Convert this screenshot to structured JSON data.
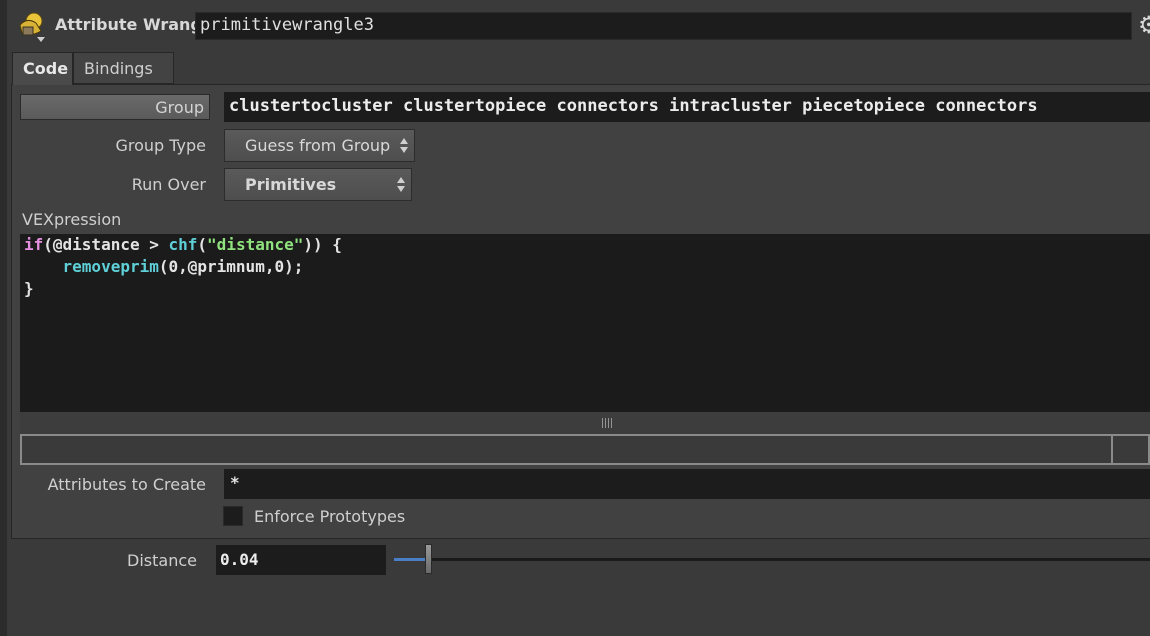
{
  "header": {
    "node_type": "Attribute Wrangle",
    "node_name": "primitivewrangle3",
    "node_icon": "wrangle-node-icon",
    "settings_icon": "gear-icon"
  },
  "tabs": [
    {
      "label": "Code",
      "active": true
    },
    {
      "label": "Bindings",
      "active": false
    }
  ],
  "params": {
    "group": {
      "label": "Group",
      "value": "clustertocluster clustertopiece connectors intracluster piecetopiece connectors"
    },
    "group_type": {
      "label": "Group Type",
      "value": "Guess from Group"
    },
    "run_over": {
      "label": "Run Over",
      "value": "Primitives"
    },
    "vexpression": {
      "label": "VEXpression",
      "code": [
        "if(@distance > chf(\"distance\")) {",
        "    removeprim(0,@primnum,0);",
        "}"
      ]
    },
    "attributes_to_create": {
      "label": "Attributes to Create",
      "value": "*"
    },
    "enforce_prototypes": {
      "label": "Enforce Prototypes",
      "checked": false
    },
    "distance": {
      "label": "Distance",
      "value": "0.04",
      "slider_fraction": 0.045
    }
  },
  "colors": {
    "background": "#3a3a3a",
    "field": "#1c1c1c",
    "keyword": "#e58fe0",
    "function": "#5fd0d8",
    "string": "#8fe27d",
    "slider_fill": "#4a7fc8"
  }
}
